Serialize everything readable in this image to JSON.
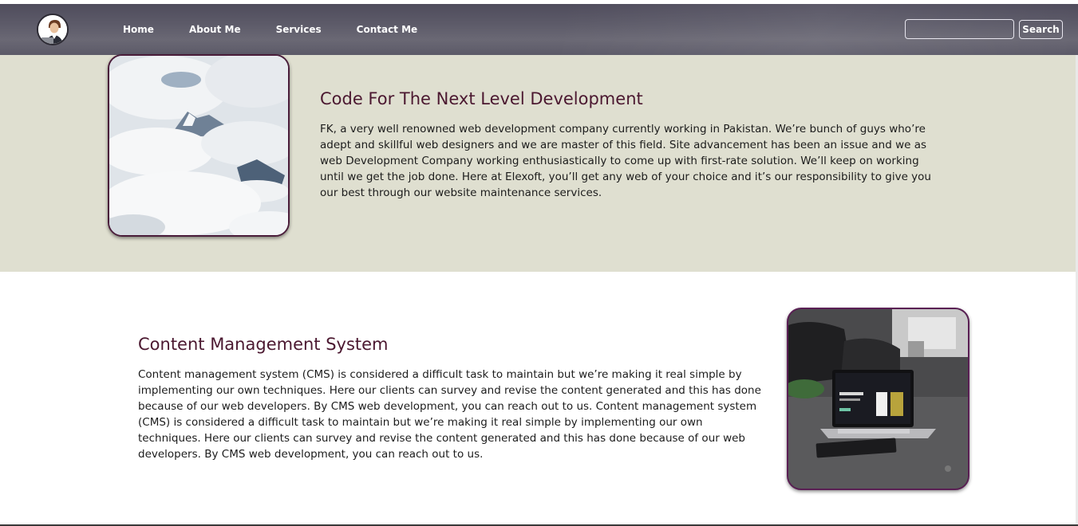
{
  "navbar": {
    "links": [
      "Home",
      "About Me",
      "Services",
      "Contact Me"
    ],
    "search": {
      "value": "",
      "placeholder": ""
    },
    "search_button_label": "Search"
  },
  "section_intro": {
    "title": "Code For The Next Level Development",
    "text": "FK, a very well renowned web development company currently working in Pakistan. We’re bunch of guys who’re adept and skillful web designers and we are master of this field. Site advancement has been an issue and we as web Development Company working enthusiastically to come up with first-rate solution. We’ll keep on working until we get the job done. Here at Elexoft, you’ll get any web of your choice and it’s our responsibility to give you our best through our website maintenance services."
  },
  "section_cms": {
    "title": "Content Management System",
    "text": "Content management system (CMS) is considered a difficult task to maintain but we’re making it real simple by implementing our own techniques. Here our clients can survey and revise the content generated and this has done because of our web developers. By CMS web development, you can reach out to us. Content management system (CMS) is considered a difficult task to maintain but we’re making it real simple by implementing our own techniques. Here our clients can survey and revise the content generated and this has done because of our web developers. By CMS web development, you can reach out to us."
  },
  "colors": {
    "navbar": "#5d5b69",
    "section_intro_bg": "#dfdfd0",
    "heading": "#4b1830",
    "image_border": "#4a1d3a"
  },
  "icons": {
    "avatar": "user-avatar-icon",
    "image1": "mountain-clouds-image",
    "image2": "laptop-desk-image"
  }
}
